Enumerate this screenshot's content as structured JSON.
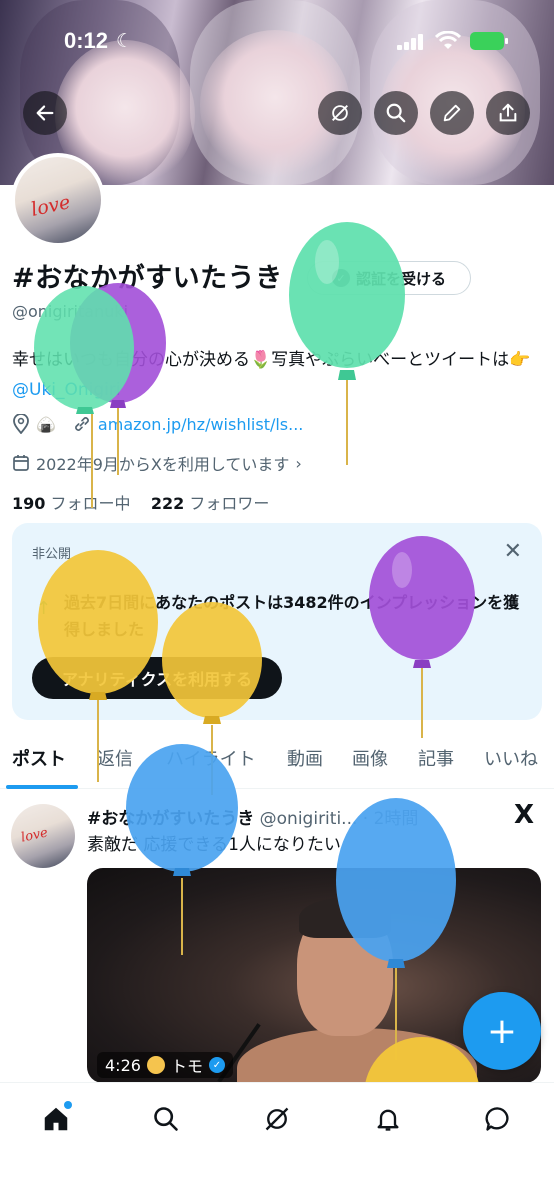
{
  "status_bar": {
    "time": "0:12"
  },
  "profile": {
    "name": "#おなかがすいたうき",
    "handle": "@onigiritanuki",
    "bio_text": "幸せはいつも自分の心が決める🌷写真やぷらいべーとツイートは👉",
    "bio_link": "@Uki_Onigiri",
    "location_emoji": "🍙",
    "website": "amazon.jp/hz/wishlist/ls...",
    "joined": "2022年9月からXを利用しています",
    "following_count": "190",
    "following_label": "フォロー中",
    "followers_count": "222",
    "followers_label": "フォロワー",
    "verify_button": "認証を受ける",
    "avatar_text": "love"
  },
  "analytics_card": {
    "label": "非公開",
    "message": "過去7日間にあなたのポストは3482件のインプレッションを獲得しました",
    "button": "アナリティクスを利用する"
  },
  "tabs": [
    "ポスト",
    "返信",
    "ハイライト",
    "動画",
    "画像",
    "記事",
    "いいね"
  ],
  "post": {
    "author": "#おなかがすいたうき",
    "handle": "@onigiriti...",
    "time": "· 2時間",
    "text": "素敵だ  応援できる1人になりたい",
    "video_duration": "4:26",
    "video_channel": "トモ",
    "platform_icon": "X"
  },
  "colors": {
    "accent": "#1d9bf0",
    "text": "#0f1419",
    "secondary": "#536471",
    "card_bg": "#e8f5fd",
    "balloon_green": "#5fe0ad",
    "balloon_purple": "#a24fd8",
    "balloon_yellow": "#f2c63a",
    "balloon_blue": "#4aa3f0"
  },
  "icons": {
    "back": "arrow-left-icon",
    "topic": "grok-icon",
    "search": "search-icon",
    "edit": "pencil-icon",
    "share": "share-icon",
    "location": "location-pin-icon",
    "link": "link-icon",
    "calendar": "calendar-icon",
    "close": "close-icon",
    "fab": "plus-icon",
    "nav": [
      "home-icon",
      "search-icon",
      "grok-icon",
      "bell-icon",
      "message-icon"
    ]
  }
}
